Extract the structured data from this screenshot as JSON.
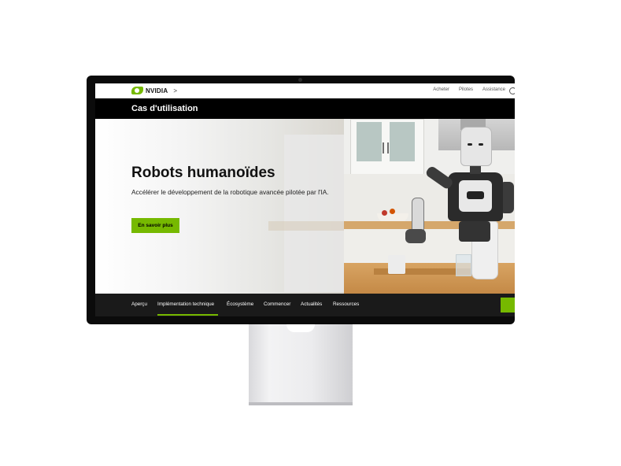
{
  "topnav": {
    "brand": "NVIDIA",
    "chevron": ">",
    "links": [
      "Acheter",
      "Pilotes",
      "Assistance"
    ],
    "globe_icon": "globe-icon"
  },
  "section": {
    "title": "Cas d'utilisation"
  },
  "hero": {
    "title": "Robots humanoïdes",
    "subtitle": "Accélérer le développement de la robotique avancée pilotée par l'IA.",
    "cta_label": "En savoir plus"
  },
  "tabs": {
    "items": [
      "Aperçu",
      "Implémentation technique",
      "Écosystème",
      "Commencer",
      "Actualités",
      "Ressources"
    ],
    "active_index": 1
  },
  "colors": {
    "accent": "#76b900",
    "dark_bar": "#000000",
    "tab_bar": "#1a1a1a"
  }
}
